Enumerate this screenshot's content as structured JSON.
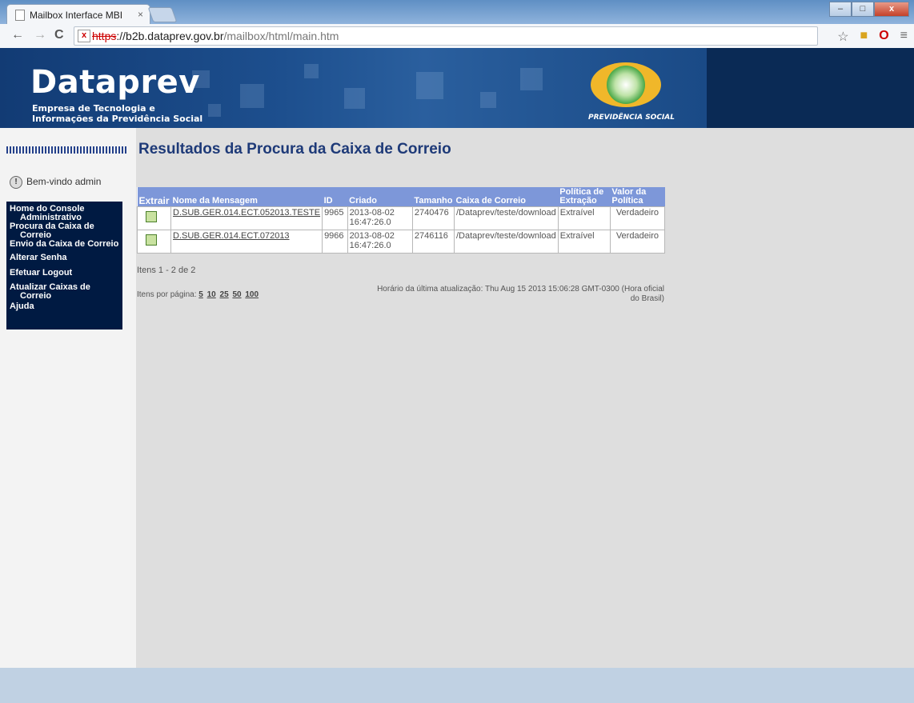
{
  "browser": {
    "tab_title": "Mailbox Interface MBI",
    "tab_close": "×",
    "url_scheme": "https",
    "url_host": "://b2b.dataprev.gov.br",
    "url_path": "/mailbox/html/main.htm"
  },
  "header": {
    "brand": "Dataprev",
    "subtitle_line1": "Empresa de Tecnologia e",
    "subtitle_line2": "Informações da Previdência Social",
    "logo_text": "PREVIDÊNCIA SOCIAL"
  },
  "sidebar": {
    "welcome": "Bem-vindo admin",
    "menu": [
      {
        "label": "Home do Console Administrativo"
      },
      {
        "label": "Procura da Caixa de Correio"
      },
      {
        "label": "Envio da Caixa de Correio"
      },
      {
        "label": "Alterar Senha"
      },
      {
        "label": "Efetuar Logout"
      },
      {
        "label": "Atualizar Caixas de Correio"
      },
      {
        "label": "Ajuda"
      }
    ]
  },
  "main": {
    "title": "Resultados da Procura da Caixa de Correio",
    "columns": [
      "Extrair",
      "Nome da Mensagem",
      "ID",
      "Criado",
      "Tamanho",
      "Caixa de Correio",
      "Política de Extração",
      "Valor da Política"
    ],
    "rows": [
      {
        "name": "D.SUB.GER.014.ECT.052013.TESTE",
        "id": "9965",
        "created": "2013-08-02 16:47:26.0",
        "size": "2740476",
        "mailbox": "/Dataprev/teste/download",
        "policy": "Extraível",
        "value": "Verdadeiro"
      },
      {
        "name": "D.SUB.GER.014.ECT.072013",
        "id": "9966",
        "created": "2013-08-02 16:47:26.0",
        "size": "2746116",
        "mailbox": "/Dataprev/teste/download",
        "policy": "Extraível",
        "value": "Verdadeiro"
      }
    ],
    "items_count": "Itens 1 - 2 de 2",
    "per_page_label": "Itens por página:",
    "per_page_options": [
      "5",
      "10",
      "25",
      "50",
      "100"
    ],
    "updated_line1": "Horário da última atualização:  Thu Aug 15 2013 15:06:28 GMT-0300 (Hora oficial",
    "updated_line2": "do Brasil)"
  }
}
